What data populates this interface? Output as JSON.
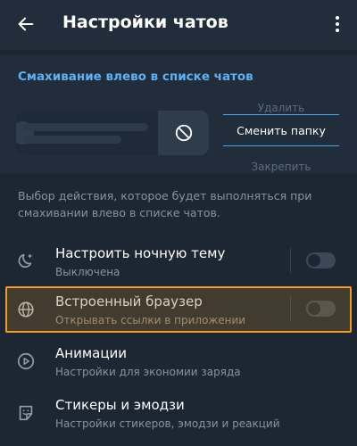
{
  "header": {
    "title": "Настройки чатов"
  },
  "swipe": {
    "title": "Смахивание влево в списке чатов",
    "options": {
      "delete": "Удалить",
      "move": "Сменить папку",
      "pin": "Закрепить"
    },
    "selected": "Сменить папку",
    "description": "Выбор действия, которое будет выполняться при смахивании влево в списке чатов."
  },
  "settings": [
    {
      "title": "Настроить ночную тему",
      "subtitle": "Выключена",
      "icon": "moon-icon",
      "toggle": false
    },
    {
      "title": "Встроенный браузер",
      "subtitle": "Открывать ссылки в приложении",
      "icon": "globe-icon",
      "toggle": false,
      "highlighted": true
    },
    {
      "title": "Анимации",
      "subtitle": "Настройки для экономии заряда",
      "icon": "play-circle-icon"
    },
    {
      "title": "Стикеры и эмодзи",
      "subtitle": "Настройки стикеров, эмодзи и реакций",
      "icon": "sticker-icon"
    }
  ],
  "colors": {
    "background": "#1c2733",
    "header": "#212d3b",
    "accent": "#5fb0f2",
    "highlight": "#f59a23"
  }
}
